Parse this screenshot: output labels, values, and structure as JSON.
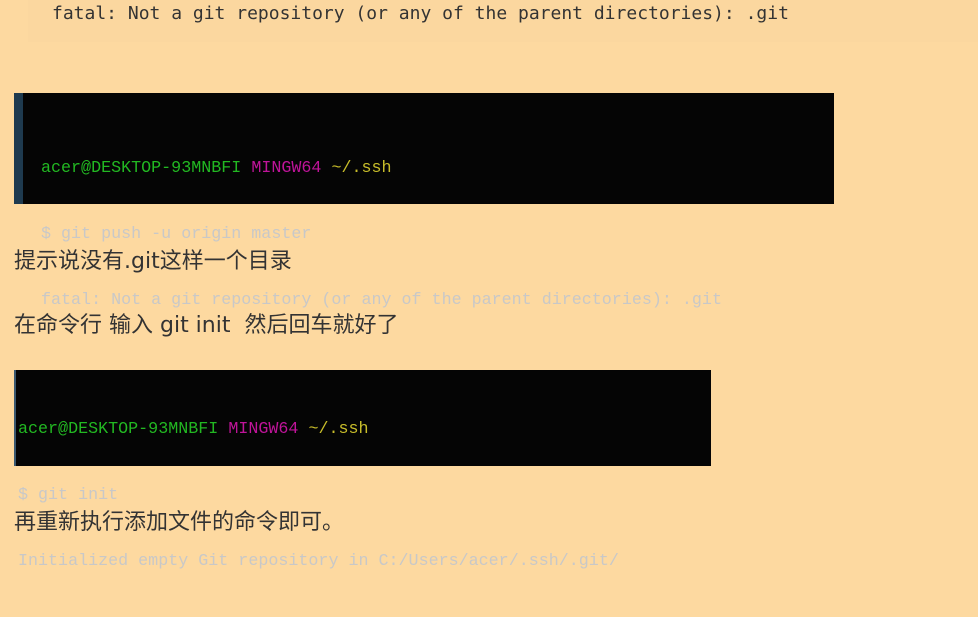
{
  "code_block": {
    "line": "fatal: Not a git repository (or any of the parent directories): .git"
  },
  "terminal1": {
    "prompt_user": "acer@DESKTOP-93MNBFI",
    "prompt_env": "MINGW64",
    "prompt_path": "~/.ssh",
    "command": "$ git push -u origin master",
    "output": "fatal: Not a git repository (or any of the parent directories): .git"
  },
  "paragraph1": "提示说没有.git这样一个目录",
  "paragraph2": "在命令行 输入 git init  然后回车就好了",
  "terminal2": {
    "prompt_user": "acer@DESKTOP-93MNBFI",
    "prompt_env": "MINGW64",
    "prompt_path": "~/.ssh",
    "command": "$ git init",
    "output": "Initialized empty Git repository in C:/Users/acer/.ssh/.git/"
  },
  "paragraph3": "再重新执行添加文件的命令即可。",
  "colors": {
    "page_background": "#fdd9a0",
    "terminal_background": "#050505",
    "prompt_user": "#22b822",
    "prompt_env": "#c0149a",
    "prompt_path": "#c8bd2a",
    "terminal_text": "#c8c8c8"
  }
}
